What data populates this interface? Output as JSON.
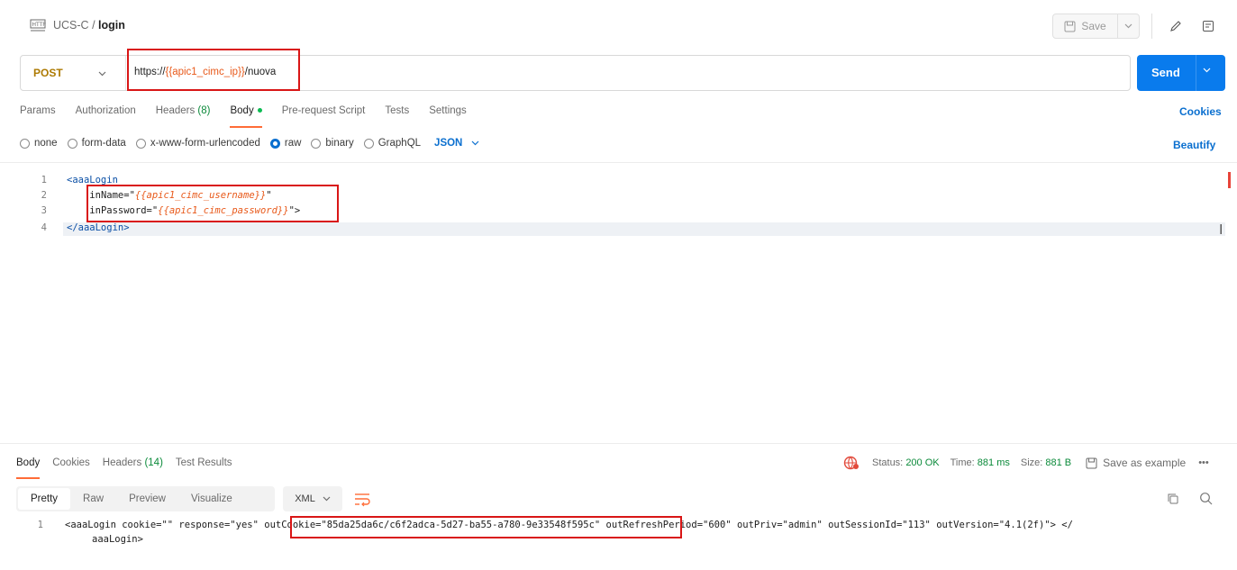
{
  "header": {
    "icon": "http-icon",
    "collection": "UCS-C",
    "separator": " / ",
    "request_name": "login",
    "save_label": "Save",
    "edit_icon": "pencil-icon",
    "docs_icon": "comment-icon"
  },
  "request": {
    "method": "POST",
    "url_prefix": "https://",
    "url_variable": "{{apic1_cimc_ip}}",
    "url_suffix": "/nuova",
    "send_label": "Send"
  },
  "tabs": [
    {
      "label": "Params"
    },
    {
      "label": "Authorization"
    },
    {
      "label": "Headers",
      "count": "(8)"
    },
    {
      "label": "Body"
    },
    {
      "label": "Pre-request Script"
    },
    {
      "label": "Tests"
    },
    {
      "label": "Settings"
    }
  ],
  "cookies_label": "Cookies",
  "body_options": {
    "none": "none",
    "form_data": "form-data",
    "urlencoded": "x-www-form-urlencoded",
    "raw": "raw",
    "binary": "binary",
    "graphql": "GraphQL",
    "format": "JSON",
    "beautify": "Beautify"
  },
  "editor": {
    "line_numbers": [
      "1",
      "2",
      "3",
      "4"
    ],
    "line1": "<aaaLogin",
    "line2_attr": "inName=",
    "line2_value": "{{apic1_cimc_username}}",
    "line3_attr": "inPassword=",
    "line3_value": "{{apic1_cimc_password}}",
    "line4": "</aaaLogin>"
  },
  "response": {
    "tabs": {
      "body": "Body",
      "cookies": "Cookies",
      "headers": "Headers",
      "headers_count": "(14)",
      "tests": "Test Results"
    },
    "status_label": "Status:",
    "status_value": "200 OK",
    "time_label": "Time:",
    "time_value": "881 ms",
    "size_label": "Size:",
    "size_value": "881 B",
    "save_example": "Save as example",
    "more": "•••",
    "views": {
      "pretty": "Pretty",
      "raw": "Raw",
      "preview": "Preview",
      "visualize": "Visualize"
    },
    "format": "XML",
    "line_number": "1",
    "body_line1": "<aaaLogin cookie=\"\" response=\"yes\" outCookie=\"85da25da6c/c6f2adca-5d27-ba55-a780-9e33548f595c\" outRefreshPeriod=\"600\" outPriv=\"admin\" outSessionId=\"113\" outVersion=\"4.1(2f)\"> </",
    "body_line2": "aaaLogin>"
  }
}
